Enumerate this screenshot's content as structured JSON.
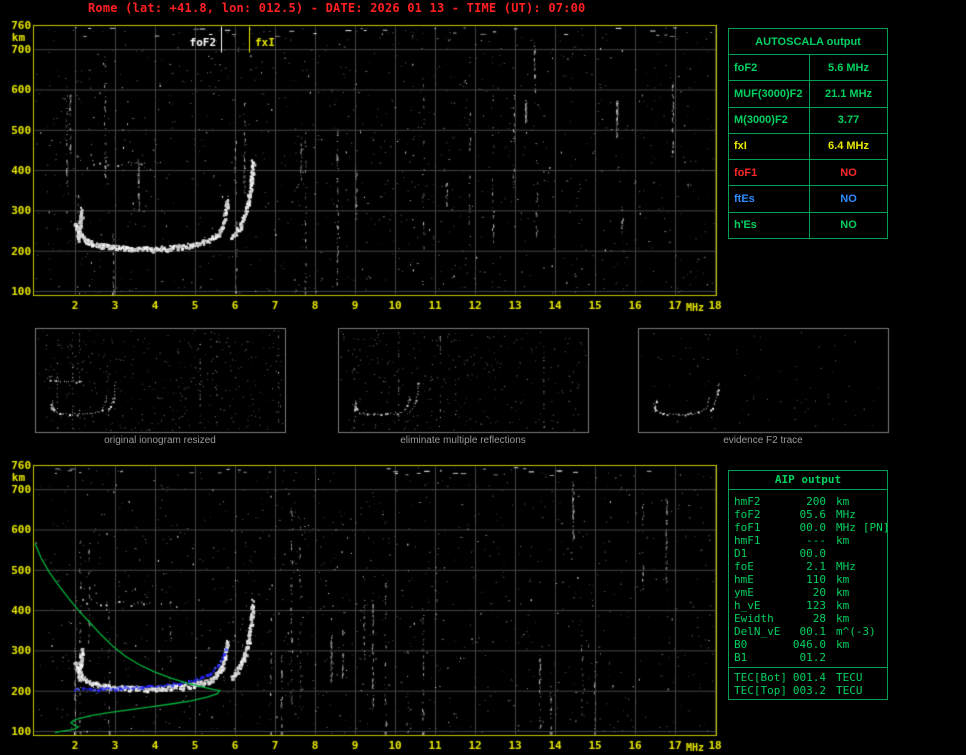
{
  "title": "Rome (lat: +41.8, lon: 012.5) - DATE: 2026 01 13 - TIME (UT): 07:00",
  "colors": {
    "background": "#000000",
    "title": "#ff2020",
    "axis": "#e8e800",
    "frame": "#c9c900",
    "grid": "#454545",
    "table_green": "#00d05f",
    "table_border": "#00a050",
    "caption_gray": "#9a9a9a",
    "thumb_border": "#7a7a7a",
    "trace_white": "#ffffff",
    "trace_blue": "#2a2aff",
    "profile_green": "#00b43c",
    "marker_fof2": "#ffffff",
    "marker_fxi": "#e8e800"
  },
  "autoscala": {
    "title": "AUTOSCALA output",
    "rows": [
      {
        "label": "foF2",
        "value": "5.6 MHz",
        "color": "#00d05f"
      },
      {
        "label": "MUF(3000)F2",
        "value": "21.1 MHz",
        "color": "#00d05f"
      },
      {
        "label": "M(3000)F2",
        "value": "3.77",
        "color": "#00d05f"
      },
      {
        "label": "fxI",
        "value": "6.4 MHz",
        "color": "#e8e800"
      },
      {
        "label": "foF1",
        "value": "NO",
        "color": "#ff2828"
      },
      {
        "label": "ftEs",
        "value": "NO",
        "color": "#2e8bff"
      },
      {
        "label": "h'Es",
        "value": "NO",
        "color": "#00d05f"
      }
    ]
  },
  "thumbnails": [
    {
      "caption": "original ionogram resized"
    },
    {
      "caption": "eliminate multiple reflections"
    },
    {
      "caption": "evidence F2 trace"
    }
  ],
  "aip": {
    "title": "AIP output",
    "rows": [
      {
        "label": "hmF2",
        "value": "200",
        "unit": "km",
        "extra": ""
      },
      {
        "label": "foF2",
        "value": "05.6",
        "unit": "MHz",
        "extra": ""
      },
      {
        "label": "foF1",
        "value": "00.0",
        "unit": "MHz",
        "extra": "[PN]"
      },
      {
        "label": "hmF1",
        "value": "---",
        "unit": "km",
        "extra": ""
      },
      {
        "label": "D1",
        "value": "00.0",
        "unit": "",
        "extra": ""
      },
      {
        "label": "foE",
        "value": "2.1",
        "unit": "MHz",
        "extra": ""
      },
      {
        "label": "hmE",
        "value": "110",
        "unit": "km",
        "extra": ""
      },
      {
        "label": "ymE",
        "value": "20",
        "unit": "km",
        "extra": ""
      },
      {
        "label": "h_vE",
        "value": "123",
        "unit": "km",
        "extra": ""
      },
      {
        "label": "Ewidth",
        "value": "28",
        "unit": "km",
        "extra": ""
      },
      {
        "label": "DelN_vE",
        "value": "00.1",
        "unit": "m^(-3)",
        "extra": ""
      },
      {
        "label": "B0",
        "value": "046.0",
        "unit": "km",
        "extra": ""
      },
      {
        "label": "B1",
        "value": "01.2",
        "unit": "",
        "extra": ""
      }
    ],
    "tec_rows": [
      {
        "label": "TEC[Bot]",
        "value": "001.4",
        "unit": "TECU"
      },
      {
        "label": "TEC[Top]",
        "value": "003.2",
        "unit": "TECU"
      }
    ]
  },
  "noise": {
    "seed": 20260113,
    "panel_base": 950,
    "panel_bright": 150,
    "panel_streaks": 24,
    "panel_dashes": 30,
    "thumb_base": [
      380,
      300,
      85
    ]
  },
  "chart_data": [
    {
      "type": "scatter",
      "name": "measured ionogram (virtual height vs frequency)",
      "xlabel": "MHz",
      "ylabel": "km",
      "xlim": [
        0.95,
        18.05
      ],
      "ylim": [
        90,
        760
      ],
      "grid": true,
      "x_ticks": [
        2,
        3,
        4,
        5,
        6,
        7,
        8,
        9,
        10,
        11,
        12,
        13,
        14,
        15,
        16,
        17,
        18
      ],
      "y_ticks": [
        760,
        700,
        600,
        500,
        400,
        300,
        200,
        100
      ],
      "markers": [
        {
          "label": "foF2",
          "freq": 5.65,
          "color": "#ffffff",
          "side": "left"
        },
        {
          "label": "fxI",
          "freq": 6.35,
          "color": "#e8e800",
          "side": "right"
        }
      ],
      "traces": [
        {
          "name": "F-trace O-mode",
          "render": "band",
          "color": "#ffffff",
          "points": [
            [
              1.98,
              272
            ],
            [
              2.03,
              258
            ],
            [
              2.08,
              248
            ],
            [
              2.15,
              238
            ],
            [
              2.25,
              228
            ],
            [
              2.4,
              220
            ],
            [
              2.6,
              214
            ],
            [
              2.9,
              210
            ],
            [
              3.3,
              207
            ],
            [
              3.8,
              206
            ],
            [
              4.3,
              208
            ],
            [
              4.7,
              212
            ],
            [
              5.0,
              217
            ],
            [
              5.25,
              224
            ],
            [
              5.45,
              234
            ],
            [
              5.58,
              247
            ],
            [
              5.66,
              262
            ],
            [
              5.72,
              282
            ],
            [
              5.76,
              305
            ],
            [
              5.8,
              330
            ]
          ]
        },
        {
          "name": "low-frequency cusp",
          "render": "band",
          "color": "#ffffff",
          "points": [
            [
              2.06,
              232
            ],
            [
              2.1,
              258
            ],
            [
              2.13,
              284
            ],
            [
              2.16,
              308
            ]
          ]
        },
        {
          "name": "F-trace X-mode rising branch",
          "render": "band",
          "color": "#ffffff",
          "points": [
            [
              5.9,
              232
            ],
            [
              6.0,
              246
            ],
            [
              6.12,
              264
            ],
            [
              6.22,
              288
            ],
            [
              6.3,
              318
            ],
            [
              6.36,
              352
            ],
            [
              6.4,
              390
            ],
            [
              6.43,
              425
            ]
          ]
        },
        {
          "name": "second hop (multiple reflection)",
          "render": "sparse",
          "color": "#cccccc",
          "points": [
            [
              1.98,
              432
            ],
            [
              2.2,
              426
            ],
            [
              2.5,
              421
            ],
            [
              2.9,
              418
            ],
            [
              3.4,
              416
            ],
            [
              3.9,
              417
            ],
            [
              4.3,
              419
            ]
          ]
        }
      ]
    },
    {
      "type": "scatter",
      "name": "ionogram with restored trace and electron density profile",
      "xlabel": "MHz",
      "ylabel": "km",
      "xlim": [
        0.95,
        18.05
      ],
      "ylim": [
        90,
        760
      ],
      "grid": true,
      "x_ticks": [
        2,
        3,
        4,
        5,
        6,
        7,
        8,
        9,
        10,
        11,
        12,
        13,
        14,
        15,
        16,
        17,
        18
      ],
      "y_ticks": [
        760,
        700,
        600,
        500,
        400,
        300,
        200,
        100
      ],
      "markers": [],
      "traces": [
        {
          "name": "F-trace O-mode",
          "render": "band",
          "color": "#ffffff",
          "points": [
            [
              1.98,
              272
            ],
            [
              2.03,
              258
            ],
            [
              2.08,
              248
            ],
            [
              2.15,
              238
            ],
            [
              2.25,
              228
            ],
            [
              2.4,
              220
            ],
            [
              2.6,
              214
            ],
            [
              2.9,
              210
            ],
            [
              3.3,
              207
            ],
            [
              3.8,
              206
            ],
            [
              4.3,
              208
            ],
            [
              4.7,
              212
            ],
            [
              5.0,
              217
            ],
            [
              5.25,
              224
            ],
            [
              5.45,
              234
            ],
            [
              5.58,
              247
            ],
            [
              5.66,
              262
            ],
            [
              5.72,
              282
            ],
            [
              5.76,
              305
            ],
            [
              5.8,
              330
            ]
          ]
        },
        {
          "name": "low-frequency cusp",
          "render": "band",
          "color": "#ffffff",
          "points": [
            [
              2.06,
              232
            ],
            [
              2.1,
              258
            ],
            [
              2.13,
              284
            ],
            [
              2.16,
              308
            ]
          ]
        },
        {
          "name": "F-trace X-mode rising branch",
          "render": "band",
          "color": "#ffffff",
          "points": [
            [
              5.9,
              232
            ],
            [
              6.0,
              246
            ],
            [
              6.12,
              264
            ],
            [
              6.22,
              288
            ],
            [
              6.3,
              318
            ],
            [
              6.36,
              352
            ],
            [
              6.4,
              390
            ],
            [
              6.43,
              425
            ]
          ]
        },
        {
          "name": "second hop (multiple reflection)",
          "render": "sparse",
          "color": "#cccccc",
          "points": [
            [
              1.98,
              432
            ],
            [
              2.2,
              426
            ],
            [
              2.5,
              421
            ],
            [
              2.9,
              418
            ],
            [
              3.4,
              416
            ],
            [
              3.9,
              417
            ]
          ]
        },
        {
          "name": "restored trace",
          "render": "dots",
          "color": "#2a2aff",
          "points": [
            [
              1.98,
              205
            ],
            [
              2.5,
              206
            ],
            [
              3.0,
              208
            ],
            [
              3.5,
              210
            ],
            [
              4.0,
              213
            ],
            [
              4.4,
              218
            ],
            [
              4.8,
              225
            ],
            [
              5.1,
              233
            ],
            [
              5.35,
              244
            ],
            [
              5.5,
              257
            ],
            [
              5.62,
              272
            ],
            [
              5.7,
              290
            ],
            [
              5.76,
              308
            ]
          ]
        },
        {
          "name": "electron density profile N(h)",
          "render": "line",
          "color": "#00b43c",
          "points": [
            [
              1.0,
              565
            ],
            [
              1.15,
              530
            ],
            [
              1.35,
              495
            ],
            [
              1.6,
              460
            ],
            [
              1.85,
              428
            ],
            [
              2.1,
              398
            ],
            [
              2.38,
              368
            ],
            [
              2.66,
              338
            ],
            [
              2.95,
              310
            ],
            [
              3.25,
              286
            ],
            [
              3.6,
              265
            ],
            [
              4.0,
              246
            ],
            [
              4.4,
              231
            ],
            [
              4.8,
              219
            ],
            [
              5.15,
              210
            ],
            [
              5.45,
              203
            ],
            [
              5.62,
              200
            ],
            [
              5.55,
              192
            ],
            [
              5.3,
              184
            ],
            [
              4.9,
              175
            ],
            [
              4.4,
              167
            ],
            [
              3.85,
              159
            ],
            [
              3.3,
              152
            ],
            [
              2.8,
              145
            ],
            [
              2.4,
              138
            ],
            [
              2.1,
              131
            ],
            [
              1.95,
              125
            ],
            [
              1.9,
              120
            ],
            [
              1.98,
              115
            ],
            [
              2.08,
              110
            ],
            [
              2.0,
              105
            ],
            [
              1.85,
              102
            ],
            [
              1.65,
              99
            ],
            [
              1.5,
              96
            ]
          ]
        }
      ]
    }
  ]
}
